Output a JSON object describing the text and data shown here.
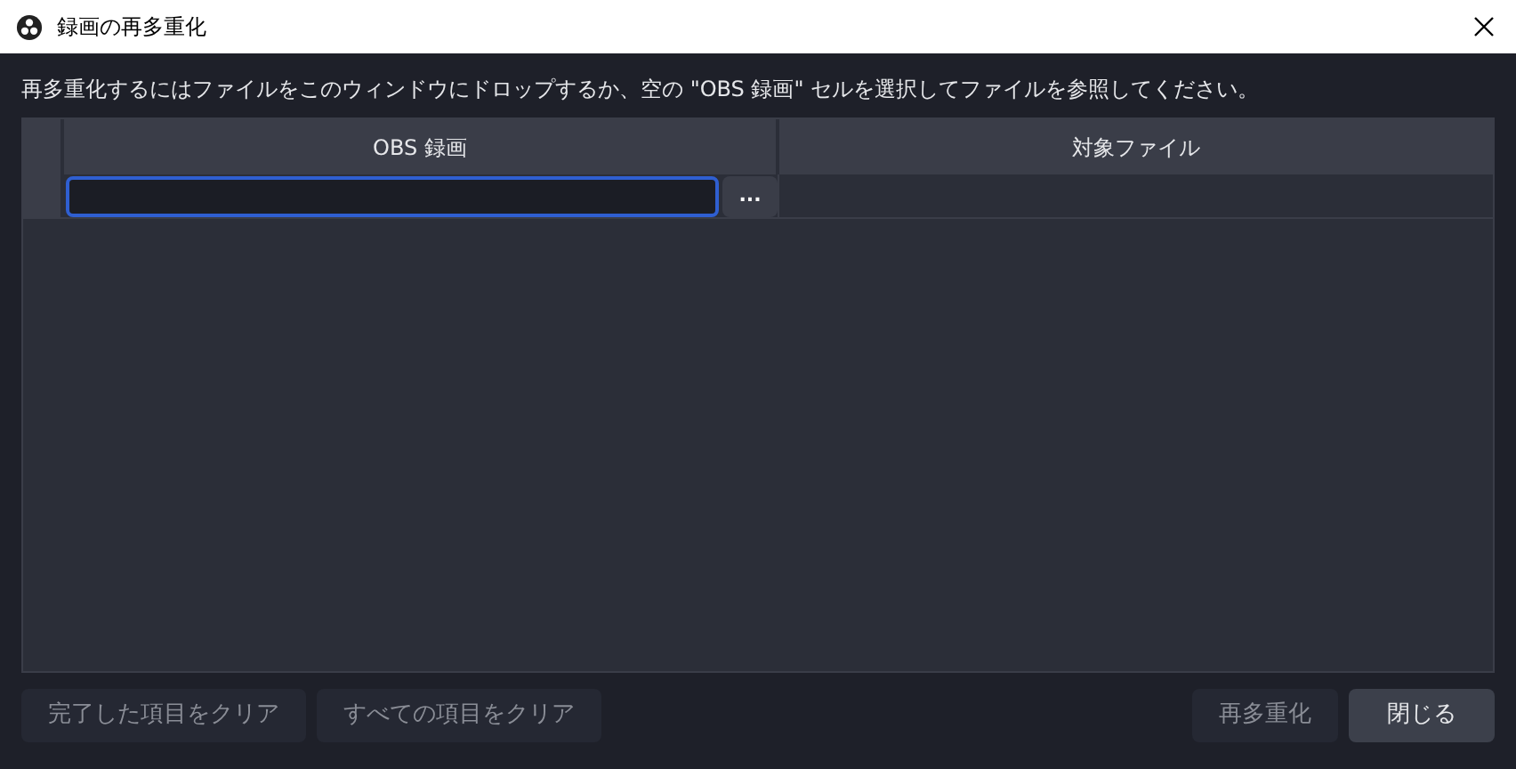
{
  "window": {
    "title": "録画の再多重化"
  },
  "instruction": "再多重化するにはファイルをこのウィンドウにドロップするか、空の \"OBS 録画\" セルを選択してファイルを参照してください。",
  "table": {
    "columns": [
      "OBS 録画",
      "対象ファイル"
    ],
    "rows": [
      {
        "browse_button": "...",
        "focused": true
      }
    ]
  },
  "left_buttons": [
    {
      "label": "完了した項目をクリア",
      "disabled": true
    },
    {
      "label": "すべての項目をクリア",
      "disabled": true
    }
  ],
  "right_buttons": [
    {
      "label": "再多重化",
      "disabled": true
    },
    {
      "label": "閉じる",
      "disabled": false
    }
  ]
}
